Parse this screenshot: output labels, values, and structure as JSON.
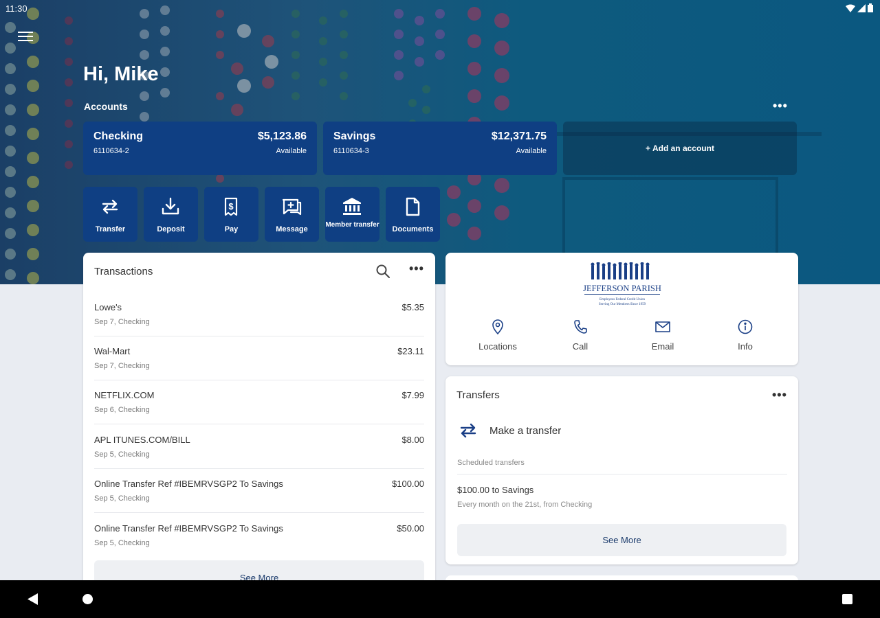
{
  "status_bar": {
    "time": "11:30"
  },
  "header": {
    "greeting": "Hi, Mike",
    "accounts_label": "Accounts",
    "more_label": "•••"
  },
  "accounts": [
    {
      "name": "Checking",
      "number": "6110634-2",
      "balance": "$5,123.86",
      "balance_label": "Available"
    },
    {
      "name": "Savings",
      "number": "6110634-3",
      "balance": "$12,371.75",
      "balance_label": "Available"
    }
  ],
  "add_account_label": "+ Add an account",
  "actions": [
    {
      "label": "Transfer",
      "icon": "transfer-icon"
    },
    {
      "label": "Deposit",
      "icon": "deposit-icon"
    },
    {
      "label": "Pay",
      "icon": "bill-pay-icon"
    },
    {
      "label": "Message",
      "icon": "message-icon"
    },
    {
      "label": "Member transfer",
      "icon": "bank-icon"
    },
    {
      "label": "Documents",
      "icon": "document-icon"
    }
  ],
  "transactions": {
    "title": "Transactions",
    "more_label": "•••",
    "items": [
      {
        "description": "Lowe's",
        "sub": "Sep 7, Checking",
        "amount": "$5.35"
      },
      {
        "description": "Wal-Mart",
        "sub": "Sep 7, Checking",
        "amount": "$23.11"
      },
      {
        "description": "NETFLIX.COM",
        "sub": "Sep 6, Checking",
        "amount": "$7.99"
      },
      {
        "description": "APL ITUNES.COM/BILL",
        "sub": "Sep 5, Checking",
        "amount": "$8.00"
      },
      {
        "description": "Online Transfer Ref #IBEMRVSGP2 To Savings",
        "sub": "Sep 5, Checking",
        "amount": "$100.00"
      },
      {
        "description": "Online Transfer Ref #IBEMRVSGP2 To Savings",
        "sub": "Sep 5, Checking",
        "amount": "$50.00"
      }
    ],
    "see_more": "See More"
  },
  "credit_union": {
    "logo_name": "JEFFERSON PARISH",
    "logo_tagline_1": "Employees Federal Credit Union",
    "logo_tagline_2": "Serving Our Members Since 1959",
    "contacts": [
      {
        "label": "Locations",
        "icon": "location-pin-icon"
      },
      {
        "label": "Call",
        "icon": "phone-icon"
      },
      {
        "label": "Email",
        "icon": "email-icon"
      },
      {
        "label": "Info",
        "icon": "info-icon"
      }
    ]
  },
  "transfers": {
    "title": "Transfers",
    "more_label": "•••",
    "make_transfer": "Make a transfer",
    "scheduled_label": "Scheduled transfers",
    "scheduled_item": {
      "title": "$100.00 to Savings",
      "sub": "Every month on the 21st, from Checking"
    },
    "see_more": "See More"
  },
  "colors": {
    "accent": "#0f3f83",
    "hero_background": "#1b4a72",
    "page_background": "#e9ecf2"
  }
}
